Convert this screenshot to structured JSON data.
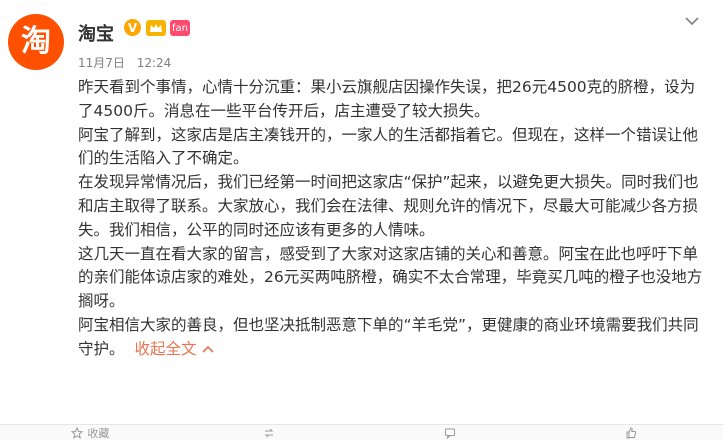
{
  "post": {
    "author": "淘宝",
    "avatar_glyph": "淘",
    "verified_badge": "V",
    "vip_icon": "crown-icon",
    "tag_badge": "fan",
    "date": "11月7日",
    "time": "12:24",
    "paragraphs": [
      "昨天看到个事情，心情十分沉重：果小云旗舰店因操作失误，把26元4500克的脐橙，设为了4500斤。消息在一些平台传开后，店主遭受了较大损失。",
      "阿宝了解到，这家店是店主凑钱开的，一家人的生活都指着它。但现在，这样一个错误让他们的生活陷入了不确定。",
      "在发现异常情况后，我们已经第一时间把这家店“保护”起来，以避免更大损失。同时我们也和店主取得了联系。大家放心，我们会在法律、规则允许的情况下，尽最大可能减少各方损失。我们相信，公平的同时还应该有更多的人情味。",
      "这几天一直在看大家的留言，感受到了大家对这家店铺的关心和善意。阿宝在此也呼吁下单的亲们能体谅店家的难处，26元买两吨脐橙，确实不太合常理，毕竟买几吨的橙子也没地方搁呀。"
    ],
    "last_paragraph": "阿宝相信大家的善良，但也坚决抵制恶意下单的“羊毛党”，更健康的商业环境需要我们共同守护。",
    "collapse_label": "收起全文"
  },
  "footer": {
    "favorite_label": "收藏",
    "repost_count": "",
    "comment_count": "",
    "like_count": ""
  },
  "colors": {
    "brand": "#ff5000",
    "link": "#eb7350",
    "meta": "#808080"
  }
}
